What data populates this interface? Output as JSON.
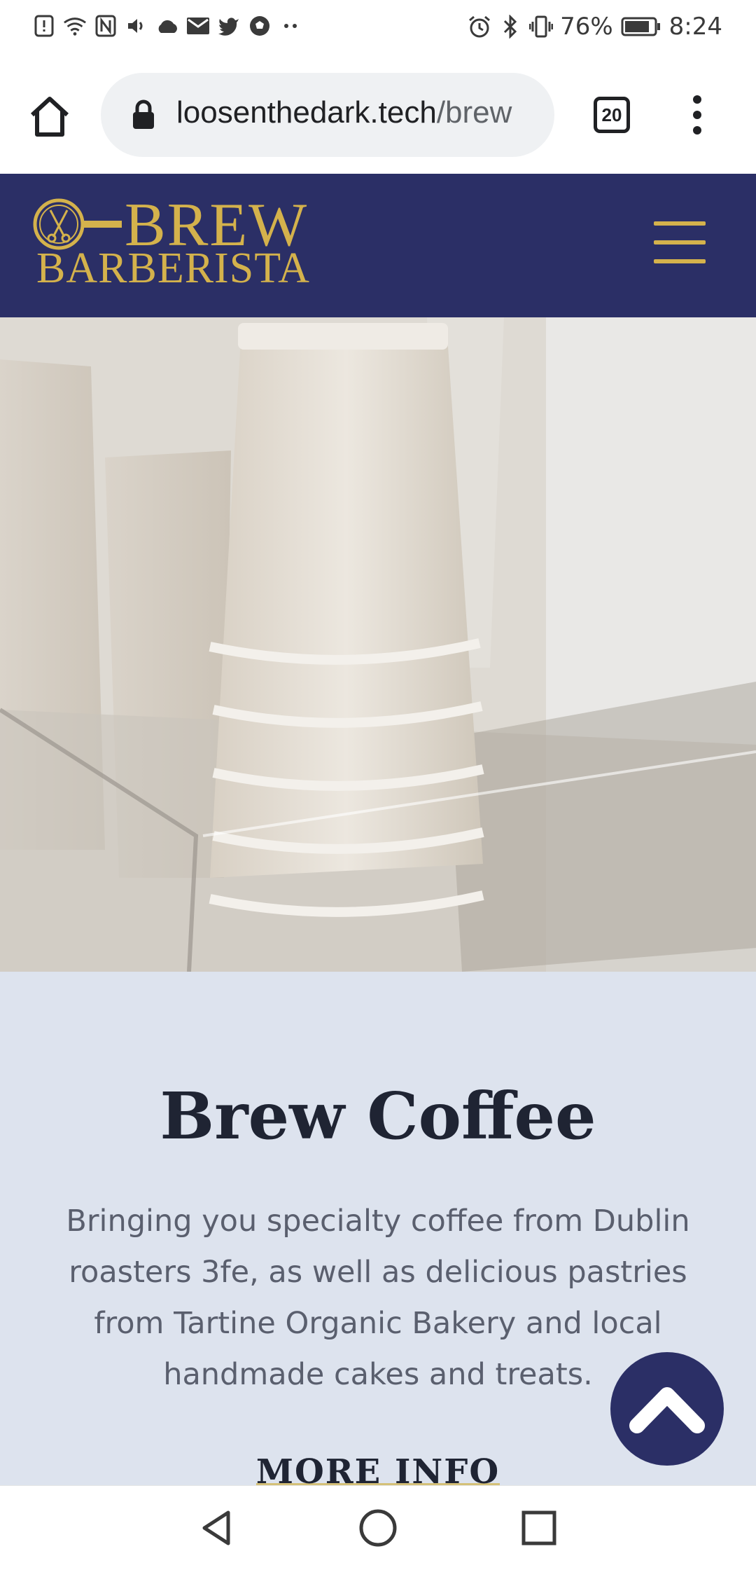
{
  "status_bar": {
    "battery": "76%",
    "time": "8:24",
    "left_icons": [
      "alert-icon",
      "wifi-icon",
      "nfc-icon",
      "volume-icon",
      "cloud-icon",
      "mail-icon",
      "twitter-icon",
      "football-icon",
      "more-dots-icon"
    ],
    "right_icons": [
      "alarm-icon",
      "bluetooth-icon",
      "vibrate-icon",
      "battery-icon"
    ]
  },
  "browser": {
    "url_domain": "loosenthedark.tech",
    "url_path": "/brew",
    "tab_count": "20"
  },
  "site": {
    "logo_word1": "BREW",
    "logo_word2": "BARBERISTA",
    "brand_color": "#d4b24c",
    "header_color": "#2b2f66"
  },
  "hero": {
    "subject": "stacked paper coffee cups"
  },
  "section": {
    "title": "Brew Coffee",
    "description": "Bringing you specialty coffee from Dublin roasters 3fe, as well as delicious pastries from Tartine Organic Bakery and local handmade cakes and treats.",
    "more_info_label": "MORE INFO"
  },
  "nav_bar": {
    "buttons": [
      "back-icon",
      "home-circle-icon",
      "recents-icon"
    ]
  }
}
